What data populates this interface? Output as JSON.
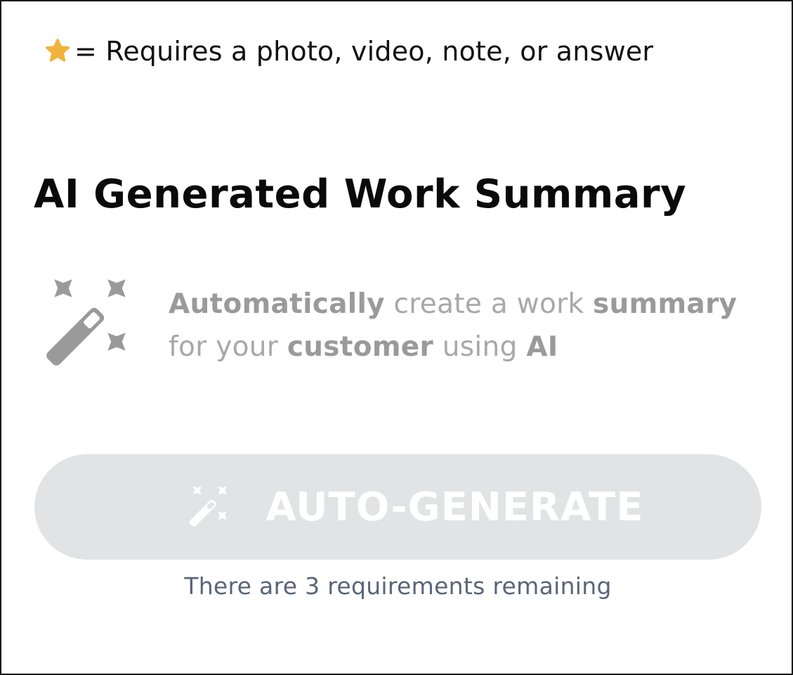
{
  "legend": {
    "icon": "star-icon",
    "icon_color": "#f0b33c",
    "text": "= Requires a photo, video, note, or answer"
  },
  "section": {
    "title": "AI Generated Work Summary"
  },
  "promo": {
    "icon": "magic-wand-icon",
    "icon_color": "#9a9a9a",
    "line1": [
      {
        "text": "Automatically",
        "bold": true
      },
      {
        "text": " create a work ",
        "bold": false
      },
      {
        "text": "summary",
        "bold": true
      }
    ],
    "line2": [
      {
        "text": "for your ",
        "bold": false
      },
      {
        "text": "customer",
        "bold": true
      },
      {
        "text": " using ",
        "bold": false
      },
      {
        "text": "AI",
        "bold": true
      }
    ]
  },
  "auto_generate_button": {
    "icon": "magic-wand-icon",
    "label": "AUTO-GENERATE",
    "state": "disabled",
    "background": "#e2e3e4",
    "text_color": "#ffffff"
  },
  "requirements": {
    "text": "There are 3 requirements remaining",
    "color": "#5a6577"
  }
}
